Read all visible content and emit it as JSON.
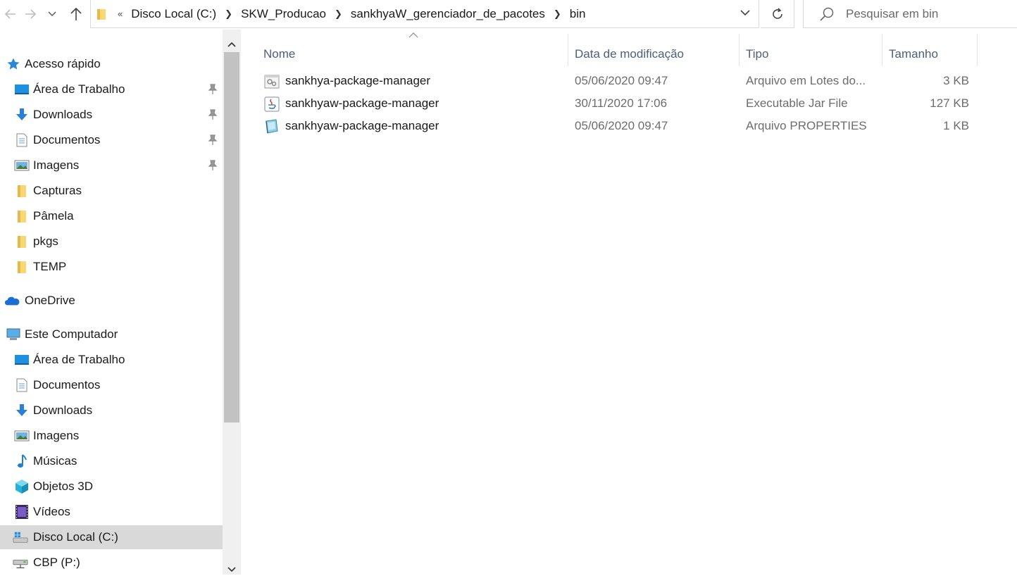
{
  "nav": {
    "back_icon": "arrow-left-icon",
    "forward_icon": "arrow-right-icon",
    "recent_icon": "chevron-down-icon",
    "up_icon": "arrow-up-icon"
  },
  "address": {
    "overflow": "«",
    "crumbs": [
      "Disco Local (C:)",
      "SKW_Producao",
      "sankhyaW_gerenciador_de_pacotes",
      "bin"
    ]
  },
  "search": {
    "placeholder": "Pesquisar em bin"
  },
  "sidebar": {
    "quick_access": {
      "label": "Acesso rápido",
      "items": [
        {
          "label": "Área de Trabalho",
          "icon": "desktop-icon",
          "pinned": true
        },
        {
          "label": "Downloads",
          "icon": "download-icon",
          "pinned": true
        },
        {
          "label": "Documentos",
          "icon": "document-icon",
          "pinned": true
        },
        {
          "label": "Imagens",
          "icon": "pictures-icon",
          "pinned": true
        },
        {
          "label": "Capturas",
          "icon": "folder-icon",
          "pinned": false
        },
        {
          "label": "Pâmela",
          "icon": "folder-icon",
          "pinned": false
        },
        {
          "label": "pkgs",
          "icon": "folder-icon",
          "pinned": false
        },
        {
          "label": "TEMP",
          "icon": "folder-icon",
          "pinned": false
        }
      ]
    },
    "onedrive": {
      "label": "OneDrive"
    },
    "this_pc": {
      "label": "Este Computador",
      "items": [
        {
          "label": "Área de Trabalho",
          "icon": "desktop-icon"
        },
        {
          "label": "Documentos",
          "icon": "document-icon"
        },
        {
          "label": "Downloads",
          "icon": "download-icon"
        },
        {
          "label": "Imagens",
          "icon": "pictures-icon"
        },
        {
          "label": "Músicas",
          "icon": "music-icon"
        },
        {
          "label": "Objetos 3D",
          "icon": "cube-icon"
        },
        {
          "label": "Vídeos",
          "icon": "video-icon"
        },
        {
          "label": "Disco Local (C:)",
          "icon": "drive-icon",
          "selected": true
        },
        {
          "label": "CBP (P:)",
          "icon": "network-drive-icon"
        }
      ]
    }
  },
  "columns": {
    "name": "Nome",
    "date": "Data de modificação",
    "type": "Tipo",
    "size": "Tamanho"
  },
  "files": [
    {
      "name": "sankhya-package-manager",
      "date": "05/06/2020 09:47",
      "type": "Arquivo em Lotes do...",
      "size": "3 KB",
      "icon": "batch-file-icon"
    },
    {
      "name": "sankhyaw-package-manager",
      "date": "30/11/2020 17:06",
      "type": "Executable Jar File",
      "size": "127 KB",
      "icon": "java-jar-icon"
    },
    {
      "name": "sankhyaw-package-manager",
      "date": "05/06/2020 09:47",
      "type": "Arquivo PROPERTIES",
      "size": "1 KB",
      "icon": "properties-file-icon"
    }
  ]
}
